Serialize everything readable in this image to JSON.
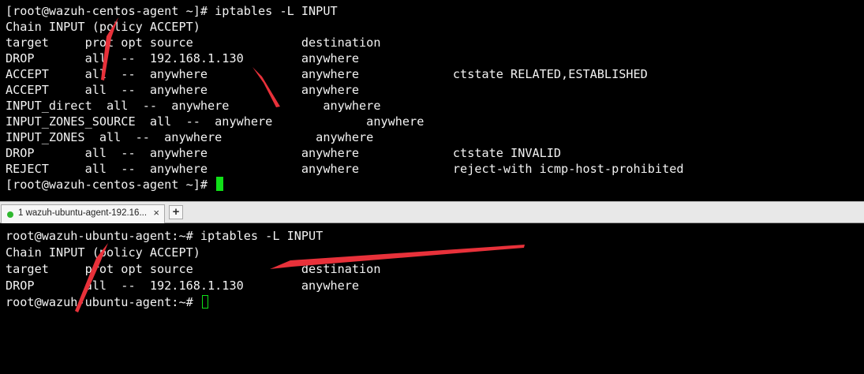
{
  "top_terminal": {
    "lines": [
      "[root@wazuh-centos-agent ~]# iptables -L INPUT",
      "Chain INPUT (policy ACCEPT)",
      "target     prot opt source               destination",
      "DROP       all  --  192.168.1.130        anywhere",
      "ACCEPT     all  --  anywhere             anywhere             ctstate RELATED,ESTABLISHED",
      "ACCEPT     all  --  anywhere             anywhere",
      "INPUT_direct  all  --  anywhere             anywhere",
      "INPUT_ZONES_SOURCE  all  --  anywhere             anywhere",
      "INPUT_ZONES  all  --  anywhere             anywhere",
      "DROP       all  --  anywhere             anywhere             ctstate INVALID",
      "REJECT     all  --  anywhere             anywhere             reject-with icmp-host-prohibited",
      "[root@wazuh-centos-agent ~]# "
    ]
  },
  "tabbar": {
    "tab_label": "1 wazuh-ubuntu-agent-192.16...",
    "close_glyph": "×",
    "add_glyph": "+",
    "status_color": "#2fb82f"
  },
  "bottom_terminal": {
    "lines": [
      "root@wazuh-ubuntu-agent:~# iptables -L INPUT",
      "Chain INPUT (policy ACCEPT)",
      "target     prot opt source               destination",
      "DROP       all  --  192.168.1.130        anywhere",
      "root@wazuh-ubuntu-agent:~# "
    ]
  },
  "colors": {
    "background": "#000000",
    "text": "#f2f2f2",
    "cursor": "#10e018",
    "annotation_arrow": "#e8313a"
  }
}
